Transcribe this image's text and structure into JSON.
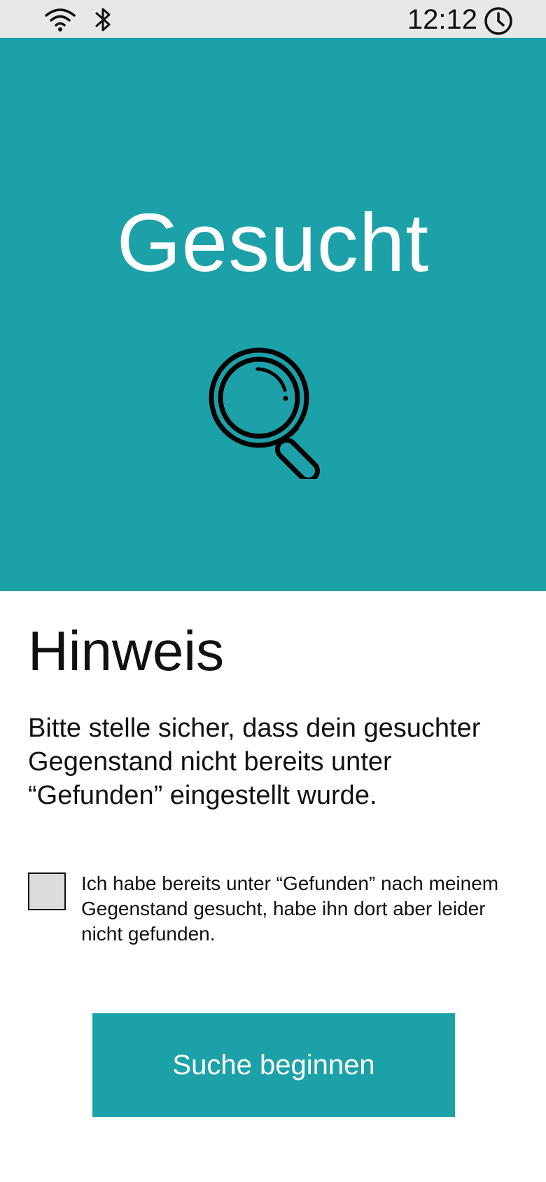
{
  "status_bar": {
    "time": "12:12",
    "icons": [
      "wifi-icon",
      "bluetooth-icon",
      "clock-icon"
    ]
  },
  "hero": {
    "title": "Gesucht",
    "icon": "search-icon",
    "background_color": "#1da1a9"
  },
  "notice": {
    "heading": "Hinweis",
    "text": "Bitte stelle sicher, dass dein gesuchter Gegenstand nicht bereits unter “Gefunden” eingestellt wurde."
  },
  "confirmation": {
    "checked": false,
    "label": "Ich habe bereits unter “Gefunden” nach meinem Gegenstand gesucht, habe ihn dort aber leider nicht gefunden."
  },
  "actions": {
    "start_search_label": "Suche beginnen",
    "button_color": "#1da1a9"
  }
}
